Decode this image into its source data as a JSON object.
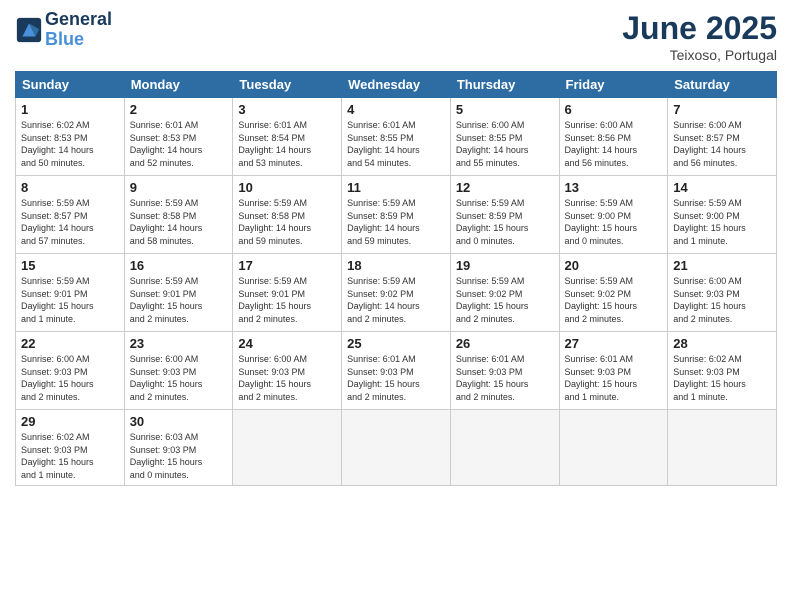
{
  "header": {
    "logo_line1": "General",
    "logo_line2": "Blue",
    "month": "June 2025",
    "location": "Teixoso, Portugal"
  },
  "weekdays": [
    "Sunday",
    "Monday",
    "Tuesday",
    "Wednesday",
    "Thursday",
    "Friday",
    "Saturday"
  ],
  "weeks": [
    [
      {
        "day": "1",
        "info": "Sunrise: 6:02 AM\nSunset: 8:53 PM\nDaylight: 14 hours\nand 50 minutes."
      },
      {
        "day": "2",
        "info": "Sunrise: 6:01 AM\nSunset: 8:53 PM\nDaylight: 14 hours\nand 52 minutes."
      },
      {
        "day": "3",
        "info": "Sunrise: 6:01 AM\nSunset: 8:54 PM\nDaylight: 14 hours\nand 53 minutes."
      },
      {
        "day": "4",
        "info": "Sunrise: 6:01 AM\nSunset: 8:55 PM\nDaylight: 14 hours\nand 54 minutes."
      },
      {
        "day": "5",
        "info": "Sunrise: 6:00 AM\nSunset: 8:55 PM\nDaylight: 14 hours\nand 55 minutes."
      },
      {
        "day": "6",
        "info": "Sunrise: 6:00 AM\nSunset: 8:56 PM\nDaylight: 14 hours\nand 56 minutes."
      },
      {
        "day": "7",
        "info": "Sunrise: 6:00 AM\nSunset: 8:57 PM\nDaylight: 14 hours\nand 56 minutes."
      }
    ],
    [
      {
        "day": "8",
        "info": "Sunrise: 5:59 AM\nSunset: 8:57 PM\nDaylight: 14 hours\nand 57 minutes."
      },
      {
        "day": "9",
        "info": "Sunrise: 5:59 AM\nSunset: 8:58 PM\nDaylight: 14 hours\nand 58 minutes."
      },
      {
        "day": "10",
        "info": "Sunrise: 5:59 AM\nSunset: 8:58 PM\nDaylight: 14 hours\nand 59 minutes."
      },
      {
        "day": "11",
        "info": "Sunrise: 5:59 AM\nSunset: 8:59 PM\nDaylight: 14 hours\nand 59 minutes."
      },
      {
        "day": "12",
        "info": "Sunrise: 5:59 AM\nSunset: 8:59 PM\nDaylight: 15 hours\nand 0 minutes."
      },
      {
        "day": "13",
        "info": "Sunrise: 5:59 AM\nSunset: 9:00 PM\nDaylight: 15 hours\nand 0 minutes."
      },
      {
        "day": "14",
        "info": "Sunrise: 5:59 AM\nSunset: 9:00 PM\nDaylight: 15 hours\nand 1 minute."
      }
    ],
    [
      {
        "day": "15",
        "info": "Sunrise: 5:59 AM\nSunset: 9:01 PM\nDaylight: 15 hours\nand 1 minute."
      },
      {
        "day": "16",
        "info": "Sunrise: 5:59 AM\nSunset: 9:01 PM\nDaylight: 15 hours\nand 2 minutes."
      },
      {
        "day": "17",
        "info": "Sunrise: 5:59 AM\nSunset: 9:01 PM\nDaylight: 15 hours\nand 2 minutes."
      },
      {
        "day": "18",
        "info": "Sunrise: 5:59 AM\nSunset: 9:02 PM\nDaylight: 14 hours\nand 2 minutes."
      },
      {
        "day": "19",
        "info": "Sunrise: 5:59 AM\nSunset: 9:02 PM\nDaylight: 15 hours\nand 2 minutes."
      },
      {
        "day": "20",
        "info": "Sunrise: 5:59 AM\nSunset: 9:02 PM\nDaylight: 15 hours\nand 2 minutes."
      },
      {
        "day": "21",
        "info": "Sunrise: 6:00 AM\nSunset: 9:03 PM\nDaylight: 15 hours\nand 2 minutes."
      }
    ],
    [
      {
        "day": "22",
        "info": "Sunrise: 6:00 AM\nSunset: 9:03 PM\nDaylight: 15 hours\nand 2 minutes."
      },
      {
        "day": "23",
        "info": "Sunrise: 6:00 AM\nSunset: 9:03 PM\nDaylight: 15 hours\nand 2 minutes."
      },
      {
        "day": "24",
        "info": "Sunrise: 6:00 AM\nSunset: 9:03 PM\nDaylight: 15 hours\nand 2 minutes."
      },
      {
        "day": "25",
        "info": "Sunrise: 6:01 AM\nSunset: 9:03 PM\nDaylight: 15 hours\nand 2 minutes."
      },
      {
        "day": "26",
        "info": "Sunrise: 6:01 AM\nSunset: 9:03 PM\nDaylight: 15 hours\nand 2 minutes."
      },
      {
        "day": "27",
        "info": "Sunrise: 6:01 AM\nSunset: 9:03 PM\nDaylight: 15 hours\nand 1 minute."
      },
      {
        "day": "28",
        "info": "Sunrise: 6:02 AM\nSunset: 9:03 PM\nDaylight: 15 hours\nand 1 minute."
      }
    ],
    [
      {
        "day": "29",
        "info": "Sunrise: 6:02 AM\nSunset: 9:03 PM\nDaylight: 15 hours\nand 1 minute."
      },
      {
        "day": "30",
        "info": "Sunrise: 6:03 AM\nSunset: 9:03 PM\nDaylight: 15 hours\nand 0 minutes."
      },
      {
        "day": "",
        "info": ""
      },
      {
        "day": "",
        "info": ""
      },
      {
        "day": "",
        "info": ""
      },
      {
        "day": "",
        "info": ""
      },
      {
        "day": "",
        "info": ""
      }
    ]
  ]
}
